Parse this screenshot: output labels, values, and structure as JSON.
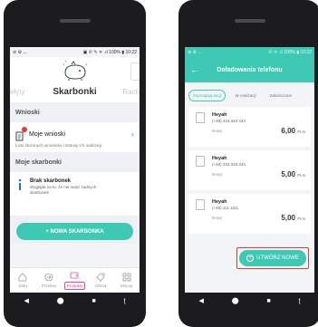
{
  "left": {
    "status": {
      "left": "⊘ ⚙ ...",
      "right": "▣ ✆ ✎ ᯤ .ıl 100% ▮ 10:22"
    },
    "header": {
      "prev_label": "ełyty",
      "title": "Skarbonki",
      "next_label": "Rach"
    },
    "wnioski": {
      "section_title": "Wnioski",
      "item_label": "Moje wnioski",
      "item_desc": "Lista złożonych wniosków i statusy ich realizacji"
    },
    "skarbonki": {
      "section_title": "Moje skarbonki",
      "empty_title": "Brak skarbonek",
      "empty_desc": "Wygląda na to, że nie masz żadnych skarbonek"
    },
    "cta": "+ NOWA SKARBONKA",
    "tabs": [
      {
        "label": "Start",
        "icon": "home-icon"
      },
      {
        "label": "Przelew",
        "icon": "arrow-right-circle-icon"
      },
      {
        "label": "Produkty",
        "icon": "wallet-icon"
      },
      {
        "label": "Oferta",
        "icon": "tag-icon"
      },
      {
        "label": "Więcej",
        "icon": "grid-icon"
      }
    ],
    "active_tab": "Produkty",
    "nav": [
      "◀",
      "⬤",
      "■",
      "ʈ"
    ]
  },
  "right": {
    "status": {
      "left": "⊘ ⚙ ...",
      "right": "✆ ᯤ .ıl 100% ▮ 10:22"
    },
    "header": {
      "back": "←",
      "title": "Doładowania telefonu"
    },
    "filters": [
      "Wymagają akcji",
      "W realizacji",
      "Zakończone"
    ],
    "active_filter": "Wymagają akcji",
    "items": [
      {
        "name": "Heyah",
        "phone": "(+48) 444 444 444",
        "state": "Nowy",
        "amount": "6,00",
        "currency": "PLN"
      },
      {
        "name": "Heyah",
        "phone": "(+48) 333 333 333",
        "state": "Nowy",
        "amount": "5,00",
        "currency": "PLN"
      },
      {
        "name": "Heyah",
        "phone": "(+48) 111 1111",
        "state": "Nowy",
        "amount": "5,00",
        "currency": "PLN"
      }
    ],
    "new_button": "UTWÓRZ NOWE",
    "nav": [
      "◀",
      "⬤",
      "■",
      "ʈ"
    ]
  },
  "colors": {
    "accent": "#3ec9b4",
    "active_tab": "#e0488b",
    "badge": "#e53935",
    "highlight_border": "#e53935"
  }
}
